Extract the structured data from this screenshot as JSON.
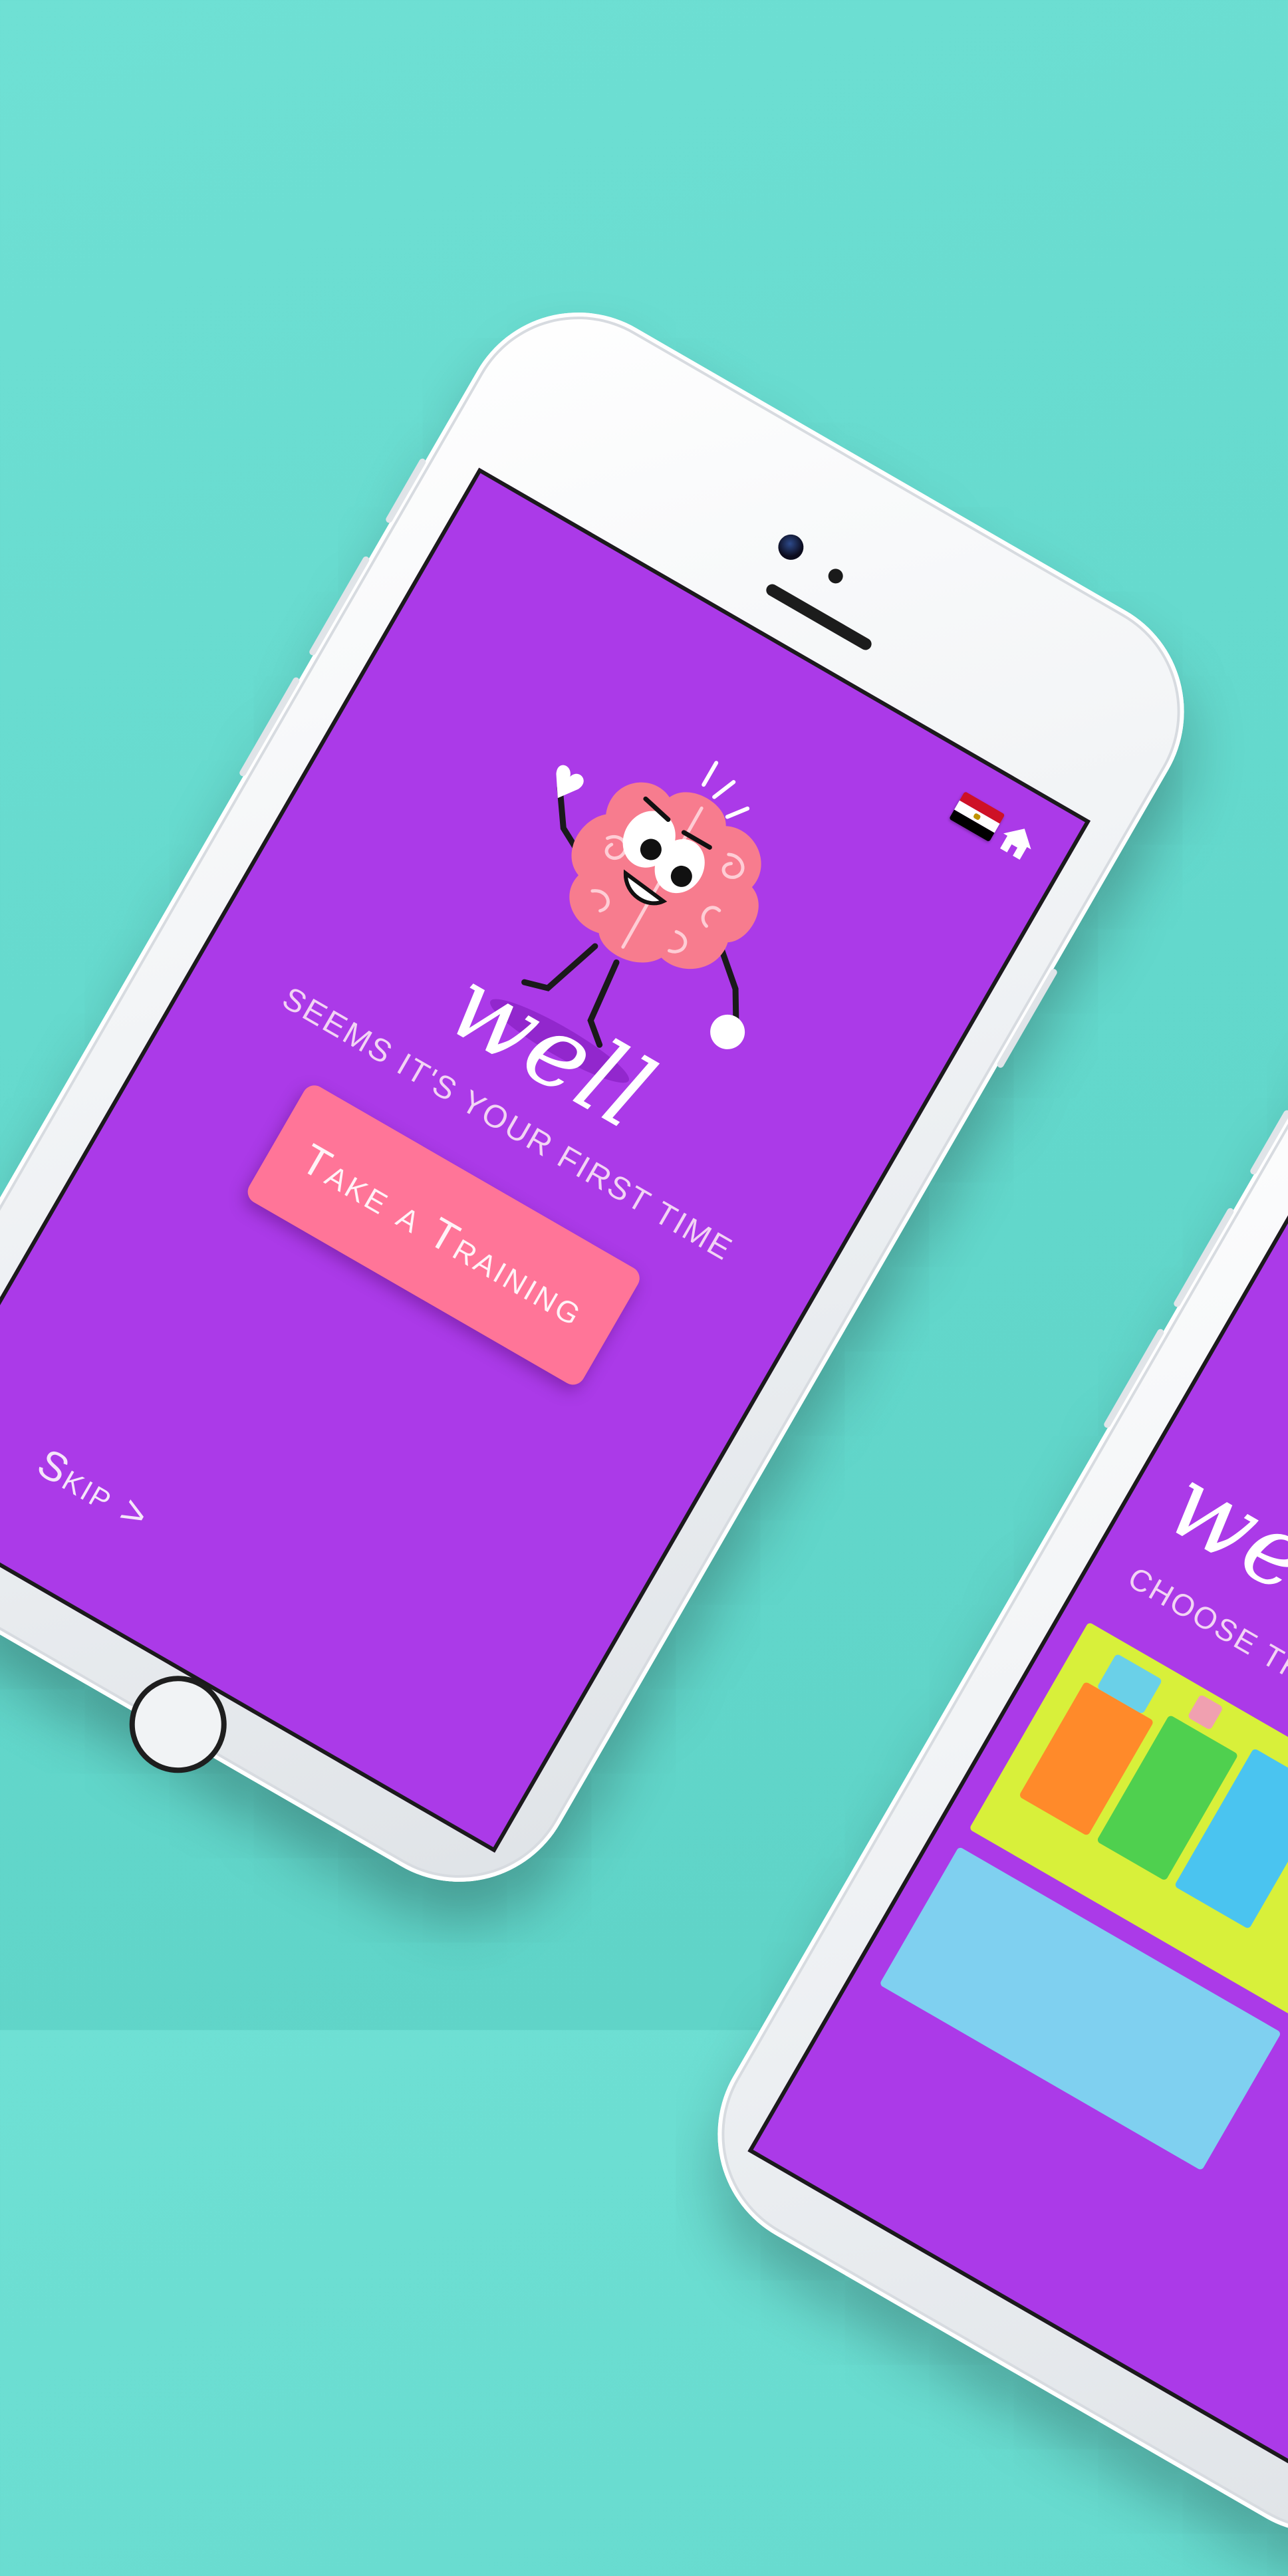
{
  "app": {
    "language_flag": "egypt-flag",
    "home_icon": "home-icon"
  },
  "welcome_screen": {
    "title": "well",
    "subtitle": "Seems it's your first time",
    "cta_label": "Take a Training",
    "skip_label": "Skip >"
  },
  "second_screen": {
    "title": "wel",
    "subtitle": "Choose th"
  },
  "colors": {
    "background": "#63d8cc",
    "screen": "#ab3ae8",
    "cta": "#ff7598",
    "mascot": "#f77c8e"
  }
}
